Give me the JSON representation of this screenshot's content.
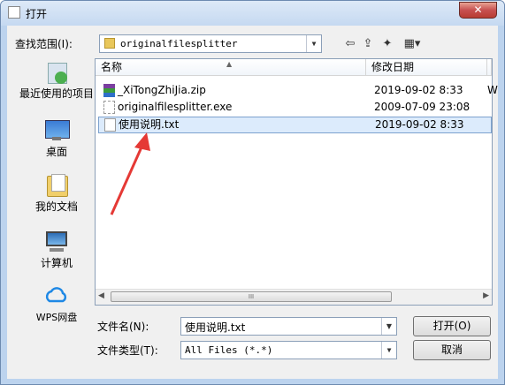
{
  "window": {
    "title": "打开",
    "close": "✕"
  },
  "lookin": {
    "label": "查找范围(I):",
    "value": "originalfilesplitter"
  },
  "places": [
    {
      "label": "最近使用的项目",
      "icon": "recent-places-icon"
    },
    {
      "label": "桌面",
      "icon": "desktop-icon"
    },
    {
      "label": "我的文档",
      "icon": "documents-icon"
    },
    {
      "label": "计算机",
      "icon": "computer-icon"
    },
    {
      "label": "WPS网盘",
      "icon": "cloud-icon"
    }
  ],
  "list": {
    "columns": [
      "名称",
      "修改日期"
    ],
    "files": [
      {
        "name": "_XiTongZhiJia.zip",
        "date": "2019-09-02 8:33",
        "icon": "archive-icon",
        "extra": "W"
      },
      {
        "name": "originalfilesplitter.exe",
        "date": "2009-07-09 23:08",
        "icon": "exe-icon",
        "extra": ""
      },
      {
        "name": "使用说明.txt",
        "date": "2019-09-02 8:33",
        "icon": "text-file-icon",
        "extra": ""
      }
    ],
    "scroll_glyph": "III"
  },
  "filename": {
    "label": "文件名(N):",
    "value": "使用说明.txt"
  },
  "filetype": {
    "label": "文件类型(T):",
    "value": "All Files (*.*)"
  },
  "buttons": {
    "open": "打开(O)",
    "cancel": "取消"
  },
  "colors": {
    "selection": "#dcebfc",
    "arrow": "#e53935",
    "title_bg": "#c5d9f1"
  }
}
